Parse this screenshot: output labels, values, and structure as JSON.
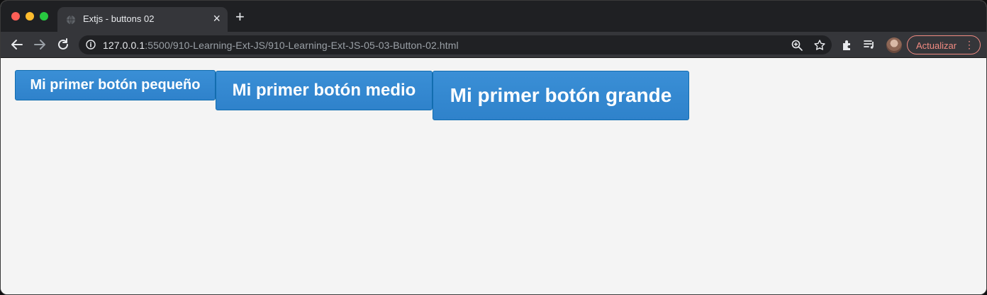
{
  "browser": {
    "tab": {
      "title": "Extjs - buttons 02",
      "close": "×"
    },
    "new_tab": "+",
    "address": {
      "host": "127.0.0.1",
      "path": ":5500/910-Learning-Ext-JS/910-Learning-Ext-JS-05-03-Button-02.html"
    },
    "update_button": {
      "label": "Actualizar",
      "menu": "⋮"
    },
    "colors": {
      "update": "#f28b82",
      "titlebar": "#1f2023",
      "toolbar": "#35363a"
    }
  },
  "page": {
    "buttons": {
      "small": "Mi primer botón pequeño",
      "medium": "Mi primer botón medio",
      "large": "Mi primer botón grande"
    },
    "colors": {
      "button": "#2f82cb",
      "button_border": "#126daf",
      "background": "#f4f4f4"
    }
  }
}
